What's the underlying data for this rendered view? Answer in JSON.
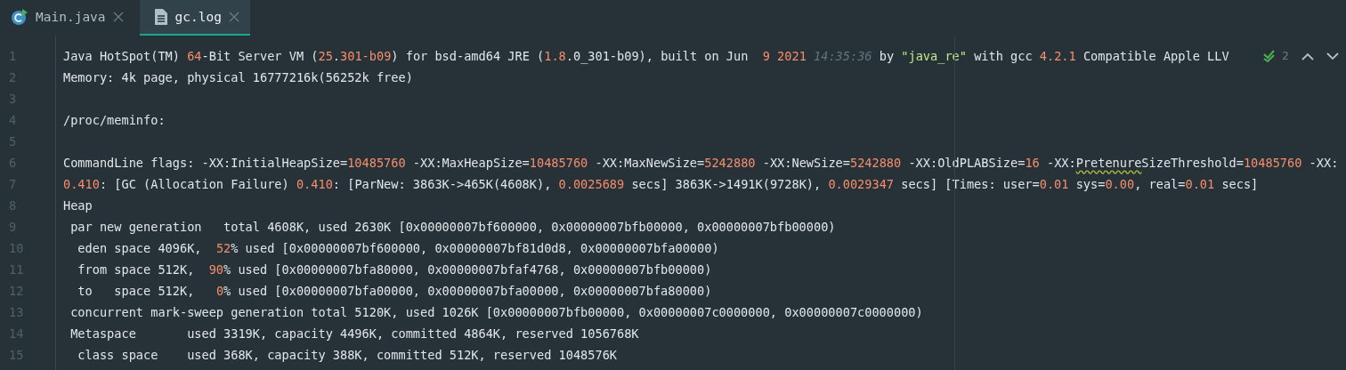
{
  "tabs": [
    {
      "label": "Main.java",
      "kind": "java-class",
      "selected": false
    },
    {
      "label": "gc.log",
      "kind": "text-file",
      "selected": true
    }
  ],
  "inspection": {
    "count": "2"
  },
  "lines": [
    {
      "number": "1",
      "segments": [
        {
          "text": "Java HotSpot(TM) ",
          "kind": "plain"
        },
        {
          "text": "64",
          "kind": "number"
        },
        {
          "text": "-Bit Server VM (",
          "kind": "plain"
        },
        {
          "text": "25",
          "kind": "number"
        },
        {
          "text": ".",
          "kind": "plain"
        },
        {
          "text": "301-b09",
          "kind": "number"
        },
        {
          "text": ") for bsd-amd64 JRE (",
          "kind": "plain"
        },
        {
          "text": "1.8",
          "kind": "number"
        },
        {
          "text": ".0_301-b09), built on Jun  ",
          "kind": "plain"
        },
        {
          "text": "9 2021",
          "kind": "number"
        },
        {
          "text": " 14:35:36",
          "kind": "italic"
        },
        {
          "text": " by ",
          "kind": "plain"
        },
        {
          "text": "\"java_re\"",
          "kind": "string"
        },
        {
          "text": " with gcc ",
          "kind": "plain"
        },
        {
          "text": "4.2.1",
          "kind": "number"
        },
        {
          "text": " Compatible Apple LLV",
          "kind": "plain"
        }
      ]
    },
    {
      "number": "2",
      "segments": [
        {
          "text": "Memory: 4k page, physical 16777216k(56252k free)",
          "kind": "plain"
        }
      ]
    },
    {
      "number": "3"
    },
    {
      "number": "4",
      "segments": [
        {
          "text": "/proc/meminfo:",
          "kind": "plain"
        }
      ]
    },
    {
      "number": "5"
    },
    {
      "number": "6",
      "segments": [
        {
          "text": "CommandLine flags: -XX:InitialHeapSize=",
          "kind": "plain"
        },
        {
          "text": "10485760",
          "kind": "number"
        },
        {
          "text": " -XX:MaxHeapSize=",
          "kind": "plain"
        },
        {
          "text": "10485760",
          "kind": "number"
        },
        {
          "text": " -XX:MaxNewSize=",
          "kind": "plain"
        },
        {
          "text": "5242880",
          "kind": "number"
        },
        {
          "text": " -XX:NewSize=",
          "kind": "plain"
        },
        {
          "text": "5242880",
          "kind": "number"
        },
        {
          "text": " -XX:OldPLABSize=",
          "kind": "plain"
        },
        {
          "text": "16",
          "kind": "number"
        },
        {
          "text": " -XX:",
          "kind": "plain"
        },
        {
          "text": "Pretenure",
          "kind": "typo"
        },
        {
          "text": "SizeThreshold=",
          "kind": "plain"
        },
        {
          "text": "10485760",
          "kind": "number"
        },
        {
          "text": " -XX:",
          "kind": "plain"
        }
      ]
    },
    {
      "number": "7",
      "segments": [
        {
          "text": "0.410",
          "kind": "number"
        },
        {
          "text": ": [GC (Allocation Failure) ",
          "kind": "plain"
        },
        {
          "text": "0.410",
          "kind": "number"
        },
        {
          "text": ": [ParNew: 3863K->465K(4608K), ",
          "kind": "plain"
        },
        {
          "text": "0.0025689",
          "kind": "number"
        },
        {
          "text": " secs] 3863K->1491K(9728K), ",
          "kind": "plain"
        },
        {
          "text": "0.0029347",
          "kind": "number"
        },
        {
          "text": " secs] [Times: user=",
          "kind": "plain"
        },
        {
          "text": "0.01",
          "kind": "number"
        },
        {
          "text": " sys=",
          "kind": "plain"
        },
        {
          "text": "0.00",
          "kind": "number"
        },
        {
          "text": ", real=",
          "kind": "plain"
        },
        {
          "text": "0.01",
          "kind": "number"
        },
        {
          "text": " secs]",
          "kind": "plain"
        }
      ]
    },
    {
      "number": "8",
      "segments": [
        {
          "text": "Heap",
          "kind": "plain"
        }
      ]
    },
    {
      "number": "9",
      "segments": [
        {
          "text": " par new generation   total 4608K, used 2630K [0x00000007bf600000, 0x00000007bfb00000, 0x00000007bfb00000)",
          "kind": "plain"
        }
      ]
    },
    {
      "number": "10",
      "segments": [
        {
          "text": "  eden space 4096K,  ",
          "kind": "plain"
        },
        {
          "text": "52",
          "kind": "number"
        },
        {
          "text": "% used [0x00000007bf600000, 0x00000007bf81d0d8, 0x00000007bfa00000)",
          "kind": "plain"
        }
      ]
    },
    {
      "number": "11",
      "segments": [
        {
          "text": "  from space 512K,  ",
          "kind": "plain"
        },
        {
          "text": "90",
          "kind": "number"
        },
        {
          "text": "% used [0x00000007bfa80000, 0x00000007bfaf4768, 0x00000007bfb00000)",
          "kind": "plain"
        }
      ]
    },
    {
      "number": "12",
      "segments": [
        {
          "text": "  to   space 512K,   ",
          "kind": "plain"
        },
        {
          "text": "0",
          "kind": "number"
        },
        {
          "text": "% used [0x00000007bfa00000, 0x00000007bfa00000, 0x00000007bfa80000)",
          "kind": "plain"
        }
      ]
    },
    {
      "number": "13",
      "segments": [
        {
          "text": " concurrent mark-sweep generation total 5120K, used 1026K [0x00000007bfb00000, 0x00000007c0000000, 0x00000007c0000000)",
          "kind": "plain"
        }
      ]
    },
    {
      "number": "14",
      "segments": [
        {
          "text": " Metaspace       used 3319K, capacity 4496K, committed 4864K, reserved 1056768K",
          "kind": "plain"
        }
      ]
    },
    {
      "number": "15",
      "segments": [
        {
          "text": "  class space    used 368K, capacity 388K, committed 512K, reserved 1048576K",
          "kind": "plain"
        }
      ]
    }
  ]
}
